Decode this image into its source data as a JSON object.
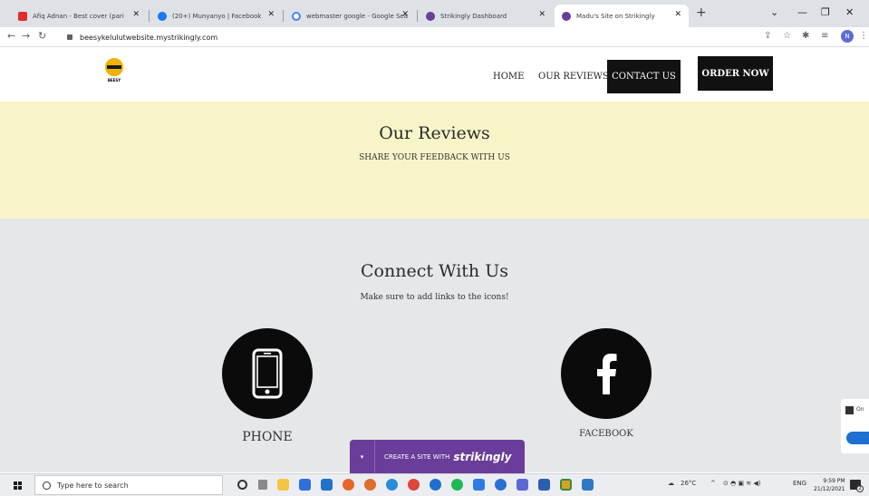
{
  "browser": {
    "tabs": [
      {
        "title": "Afiq Adnan - Best cover (pari",
        "favicon_color": "#e02d2d",
        "active": false
      },
      {
        "title": "(20+) Munyanyo | Facebook",
        "favicon_color": "#1877f2",
        "active": false
      },
      {
        "title": "webmaster google - Google Sea",
        "favicon_color": "#4285f4",
        "active": false
      },
      {
        "title": "Strikingly Dashboard",
        "favicon_color": "#6a3d9a",
        "active": false
      },
      {
        "title": "Madu's Site on Strikingly",
        "favicon_color": "#6a3d9a",
        "active": true
      }
    ],
    "url": "beesykelulutwebsite.mystrikingly.com",
    "profile_initial": "N"
  },
  "site": {
    "logo_text": "BEESY",
    "nav": {
      "home": "HOME",
      "reviews": "OUR REVIEWS",
      "contact": "CONTACT US",
      "order": "ORDER NOW"
    },
    "reviews_section": {
      "title": "Our Reviews",
      "subtitle": "SHARE YOUR FEEDBACK WITH US"
    },
    "connect_section": {
      "title": "Connect With Us",
      "subtitle": "Make sure to add links to the icons!",
      "items": [
        {
          "icon": "phone-icon",
          "label": "PHONE"
        },
        {
          "icon": "facebook-icon",
          "label": "FACEBOOK"
        }
      ]
    },
    "strikingly_banner": {
      "text": "CREATE A SITE WITH",
      "brand": "strikingly"
    },
    "side_widget_text": "On"
  },
  "taskbar": {
    "search_placeholder": "Type here to search",
    "weather": "26°C",
    "language": "ENG",
    "time": "9:59 PM",
    "date": "21/12/2021",
    "notification_count": "2"
  },
  "colors": {
    "reviews_bg": "#f7f5c8",
    "connect_bg": "#e6e7e8",
    "strikingly": "#6a3d9a"
  }
}
